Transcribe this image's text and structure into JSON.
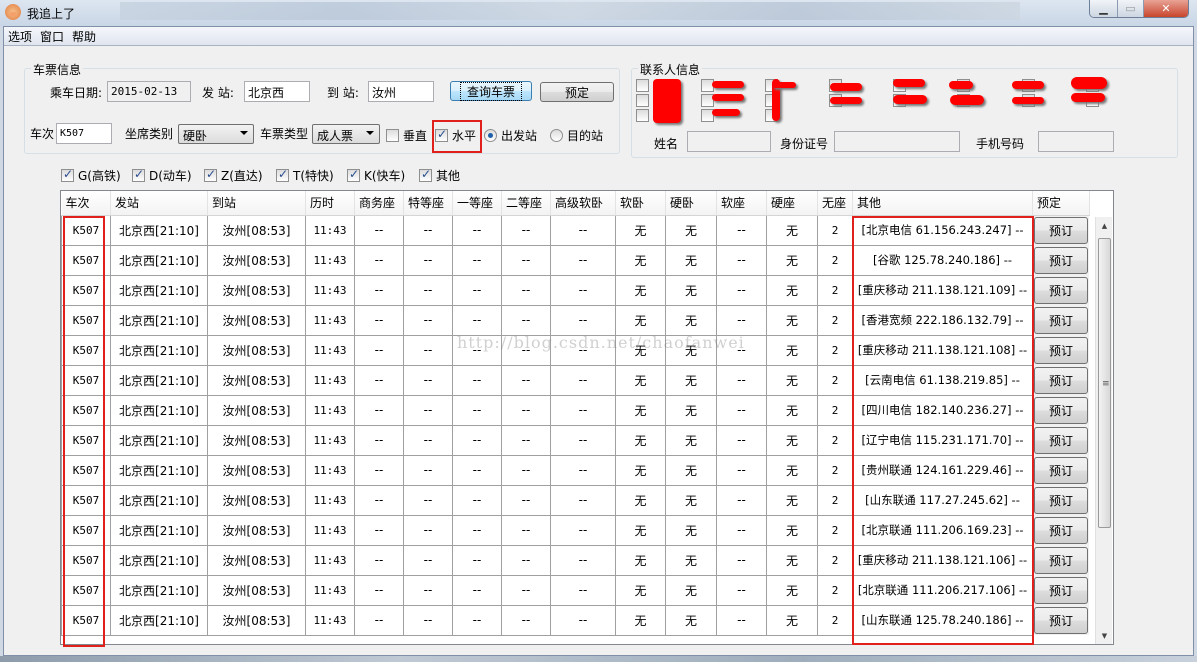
{
  "window": {
    "title": "我追上了",
    "icon": "pig-icon",
    "controls": {
      "minimize": "minimize-icon",
      "maximize": "maximize-icon",
      "close": "close-icon"
    }
  },
  "menu": [
    "选项",
    "窗口",
    "帮助"
  ],
  "ticket_info": {
    "group_label": "车票信息",
    "date_label": "乘车日期:",
    "date_value": "2015-02-13",
    "from_label": "发 站:",
    "from_value": "北京西",
    "to_label": "到 站:",
    "to_value": "汝州",
    "query_button": "查询车票",
    "book_button": "预定",
    "train_label": "车次",
    "train_value": "K507",
    "seat_label": "坐席类别",
    "seat_value": "硬卧",
    "ticket_type_label": "车票类型",
    "ticket_type_value": "成人票",
    "vertical_label": "垂直",
    "vertical_checked": false,
    "horizontal_label": "水平",
    "horizontal_checked": true,
    "radio_depart": "出发站",
    "radio_arrive": "目的站",
    "radio_selected": "出发站"
  },
  "contact_info": {
    "group_label": "联系人信息",
    "name_label": "姓名",
    "name_value": "",
    "id_label": "身份证号",
    "id_value": "",
    "phone_label": "手机号码",
    "phone_value": ""
  },
  "train_filters": [
    {
      "label": "G(高铁)",
      "checked": true
    },
    {
      "label": "D(动车)",
      "checked": true
    },
    {
      "label": "Z(直达)",
      "checked": true
    },
    {
      "label": "T(特快)",
      "checked": true
    },
    {
      "label": "K(快车)",
      "checked": true
    },
    {
      "label": "其他",
      "checked": true
    }
  ],
  "table": {
    "columns": [
      "车次",
      "发站",
      "到站",
      "历时",
      "商务座",
      "特等座",
      "一等座",
      "二等座",
      "高级软卧",
      "软卧",
      "硬卧",
      "软座",
      "硬座",
      "无座",
      "其他",
      "预定"
    ],
    "book_label": "预订",
    "rows": [
      [
        "K507",
        "北京西[21:10]",
        "汝州[08:53]",
        "11:43",
        "--",
        "--",
        "--",
        "--",
        "--",
        "无",
        "无",
        "--",
        "无",
        "2",
        "[北京电信 61.156.243.247] --"
      ],
      [
        "K507",
        "北京西[21:10]",
        "汝州[08:53]",
        "11:43",
        "--",
        "--",
        "--",
        "--",
        "--",
        "无",
        "无",
        "--",
        "无",
        "2",
        "[谷歌 125.78.240.186] --"
      ],
      [
        "K507",
        "北京西[21:10]",
        "汝州[08:53]",
        "11:43",
        "--",
        "--",
        "--",
        "--",
        "--",
        "无",
        "无",
        "--",
        "无",
        "2",
        "[重庆移动 211.138.121.109] --"
      ],
      [
        "K507",
        "北京西[21:10]",
        "汝州[08:53]",
        "11:43",
        "--",
        "--",
        "--",
        "--",
        "--",
        "无",
        "无",
        "--",
        "无",
        "2",
        "[香港宽频 222.186.132.79] --"
      ],
      [
        "K507",
        "北京西[21:10]",
        "汝州[08:53]",
        "11:43",
        "--",
        "--",
        "--",
        "--",
        "--",
        "无",
        "无",
        "--",
        "无",
        "2",
        "[重庆移动 211.138.121.108] --"
      ],
      [
        "K507",
        "北京西[21:10]",
        "汝州[08:53]",
        "11:43",
        "--",
        "--",
        "--",
        "--",
        "--",
        "无",
        "无",
        "--",
        "无",
        "2",
        "[云南电信 61.138.219.85] --"
      ],
      [
        "K507",
        "北京西[21:10]",
        "汝州[08:53]",
        "11:43",
        "--",
        "--",
        "--",
        "--",
        "--",
        "无",
        "无",
        "--",
        "无",
        "2",
        "[四川电信 182.140.236.27] --"
      ],
      [
        "K507",
        "北京西[21:10]",
        "汝州[08:53]",
        "11:43",
        "--",
        "--",
        "--",
        "--",
        "--",
        "无",
        "无",
        "--",
        "无",
        "2",
        "[辽宁电信 115.231.171.70] --"
      ],
      [
        "K507",
        "北京西[21:10]",
        "汝州[08:53]",
        "11:43",
        "--",
        "--",
        "--",
        "--",
        "--",
        "无",
        "无",
        "--",
        "无",
        "2",
        "[贵州联通 124.161.229.46] --"
      ],
      [
        "K507",
        "北京西[21:10]",
        "汝州[08:53]",
        "11:43",
        "--",
        "--",
        "--",
        "--",
        "--",
        "无",
        "无",
        "--",
        "无",
        "2",
        "[山东联通 117.27.245.62] --"
      ],
      [
        "K507",
        "北京西[21:10]",
        "汝州[08:53]",
        "11:43",
        "--",
        "--",
        "--",
        "--",
        "--",
        "无",
        "无",
        "--",
        "无",
        "2",
        "[北京联通 111.206.169.23] --"
      ],
      [
        "K507",
        "北京西[21:10]",
        "汝州[08:53]",
        "11:43",
        "--",
        "--",
        "--",
        "--",
        "--",
        "无",
        "无",
        "--",
        "无",
        "2",
        "[重庆移动 211.138.121.106] --"
      ],
      [
        "K507",
        "北京西[21:10]",
        "汝州[08:53]",
        "11:43",
        "--",
        "--",
        "--",
        "--",
        "--",
        "无",
        "无",
        "--",
        "无",
        "2",
        "[北京联通 111.206.217.106] --"
      ],
      [
        "K507",
        "北京西[21:10]",
        "汝州[08:53]",
        "11:43",
        "--",
        "--",
        "--",
        "--",
        "--",
        "无",
        "无",
        "--",
        "无",
        "2",
        "[山东联通 125.78.240.186] --"
      ]
    ]
  },
  "watermark": "http://blog.csdn.net/chaofanwei",
  "annotation_color": "#e0201a"
}
